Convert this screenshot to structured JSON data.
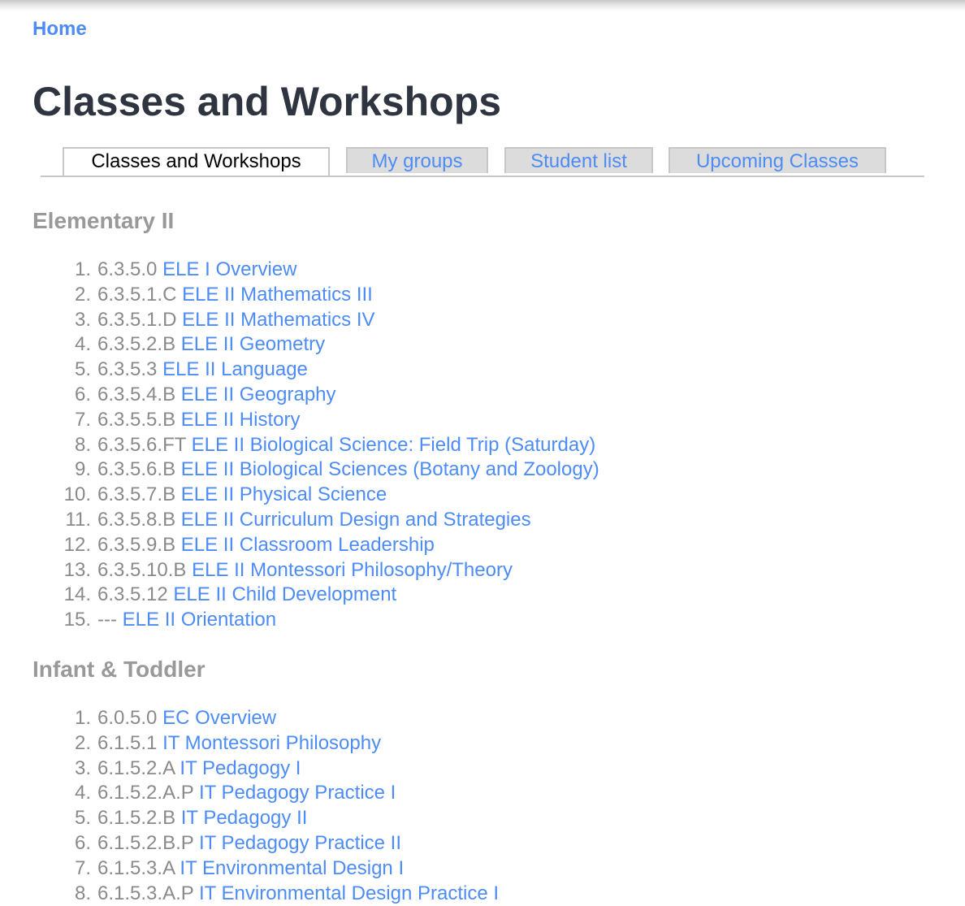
{
  "nav": {
    "home_label": "Home"
  },
  "page": {
    "title": "Classes and Workshops"
  },
  "tabs": [
    {
      "label": "Classes and Workshops",
      "active": true
    },
    {
      "label": "My groups",
      "active": false
    },
    {
      "label": "Student list",
      "active": false
    },
    {
      "label": "Upcoming Classes",
      "active": false
    }
  ],
  "sections": [
    {
      "heading": "Elementary II",
      "items": [
        {
          "num": "1.",
          "code": "6.3.5.0",
          "title": "ELE I Overview"
        },
        {
          "num": "2.",
          "code": "6.3.5.1.C",
          "title": "ELE II Mathematics III"
        },
        {
          "num": "3.",
          "code": "6.3.5.1.D",
          "title": "ELE II Mathematics IV"
        },
        {
          "num": "4.",
          "code": "6.3.5.2.B",
          "title": "ELE II Geometry"
        },
        {
          "num": "5.",
          "code": "6.3.5.3",
          "title": "ELE II Language"
        },
        {
          "num": "6.",
          "code": "6.3.5.4.B",
          "title": "ELE II Geography"
        },
        {
          "num": "7.",
          "code": "6.3.5.5.B",
          "title": "ELE II History"
        },
        {
          "num": "8.",
          "code": "6.3.5.6.FT",
          "title": "ELE II Biological Science: Field Trip (Saturday)"
        },
        {
          "num": "9.",
          "code": "6.3.5.6.B",
          "title": "ELE II Biological Sciences (Botany and Zoology)"
        },
        {
          "num": "10.",
          "code": "6.3.5.7.B",
          "title": "ELE II Physical Science"
        },
        {
          "num": "11.",
          "code": "6.3.5.8.B",
          "title": "ELE II Curriculum Design and Strategies"
        },
        {
          "num": "12.",
          "code": "6.3.5.9.B",
          "title": "ELE II Classroom Leadership"
        },
        {
          "num": "13.",
          "code": "6.3.5.10.B",
          "title": "ELE II Montessori Philosophy/Theory"
        },
        {
          "num": "14.",
          "code": "6.3.5.12",
          "title": "ELE II Child Development"
        },
        {
          "num": "15.",
          "code": "---",
          "title": "ELE II Orientation"
        }
      ]
    },
    {
      "heading": "Infant & Toddler",
      "items": [
        {
          "num": "1.",
          "code": "6.0.5.0",
          "title": "EC Overview"
        },
        {
          "num": "2.",
          "code": "6.1.5.1",
          "title": "IT Montessori Philosophy"
        },
        {
          "num": "3.",
          "code": "6.1.5.2.A",
          "title": "IT Pedagogy I"
        },
        {
          "num": "4.",
          "code": "6.1.5.2.A.P",
          "title": "IT Pedagogy Practice I"
        },
        {
          "num": "5.",
          "code": "6.1.5.2.B",
          "title": "IT Pedagogy II"
        },
        {
          "num": "6.",
          "code": "6.1.5.2.B.P",
          "title": "IT Pedagogy Practice II"
        },
        {
          "num": "7.",
          "code": "6.1.5.3.A",
          "title": "IT Environmental Design I"
        },
        {
          "num": "8.",
          "code": "6.1.5.3.A.P",
          "title": "IT Environmental Design Practice I"
        }
      ]
    }
  ],
  "colors": {
    "link": "#4d8cf5",
    "title": "#2e3540",
    "heading": "#999999",
    "muted": "#8a8a8a",
    "tab_inactive_bg": "#dcdcdc",
    "tab_border": "#c7c7c7"
  }
}
